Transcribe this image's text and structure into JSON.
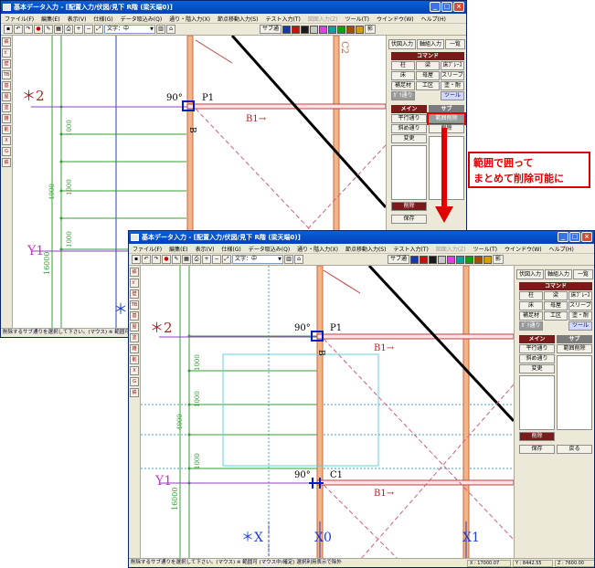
{
  "window_title": "基本データ入力 - [配置入力/伏図/見下 R階 (梁天端0)]",
  "menu": [
    "ファイル(F)",
    "編集(E)",
    "表示(V)",
    "仕様(G)",
    "データ取込み(Q)",
    "通り・階入力(X)",
    "節点移動入力(S)",
    "テスト入力(T)",
    "図面入力(Z)",
    "ツール(T)",
    "ウインドウ(W)",
    "ヘルプ(H)"
  ],
  "toolbar": {
    "font_select": "文字：中",
    "sub_label": "サブ通",
    "shadow_label": "影",
    "swatches": [
      "#1838a8",
      "#c81010",
      "#1a1a1a",
      "#c8c8c8",
      "#e040e0",
      "#10a0a0",
      "#10a010",
      "#a05000",
      "#d0a000"
    ]
  },
  "left_tools": [
    "鉄",
    "ｶﾞ",
    "壁",
    "TB",
    "基",
    "屋",
    "塗",
    "雑",
    "削",
    "X",
    "G",
    "鉄"
  ],
  "panel": {
    "tabs": [
      "伏図入力",
      "軸組入力",
      "一覧"
    ],
    "command_header": "コマンド",
    "commands": [
      "柱",
      "梁",
      "床ﾌﾞﾚｰｽ",
      "床",
      "母屋",
      "スリーブ",
      "補足材",
      "工区",
      "塗・耐"
    ],
    "commands_row4": [
      "ｶﾞﾘ通り",
      "ツール"
    ],
    "main_header": "メイン",
    "sub_header": "サブ",
    "main_items": [
      "平行通り",
      "斜め通り",
      "変更"
    ],
    "sub_top": {
      "item1": "範囲削除",
      "item2": "削除"
    },
    "sub_bottom": {
      "item1": "範囲削除",
      "item2": "削除"
    },
    "delete_btn": "削除",
    "save_btn": "保存",
    "back_btn": "戻る"
  },
  "canvas": {
    "label_star2": "＊2",
    "label_y1": "Y1",
    "label_p1": "P1",
    "label_b1": "B1→",
    "label_b": "B",
    "label_c2": "C2",
    "label_c1": "C1",
    "label_angle": "90°",
    "label_angle2": "90°",
    "label_star_x": "＊X",
    "label_x0": "X0",
    "label_x1": "X1",
    "label_star": "＊",
    "dims": [
      "1000",
      "1000",
      "1000",
      "4000",
      "1000"
    ],
    "dim_total": "16000"
  },
  "status_top": "削除するサブ通りを選択して下さい。(マウス) ※ 範囲可",
  "status_bottom": "削除するサブ通りを選択して下さい。(マウス) ※ 範囲可 (マウス中/確定) 選択利用表示で除外",
  "coords": {
    "x": "X : 17000.07",
    "y": "Y : 8442.55",
    "z": "Z : 7600.00"
  },
  "callout": {
    "line1": "範囲で囲って",
    "line2": "まとめて削除可能に"
  }
}
